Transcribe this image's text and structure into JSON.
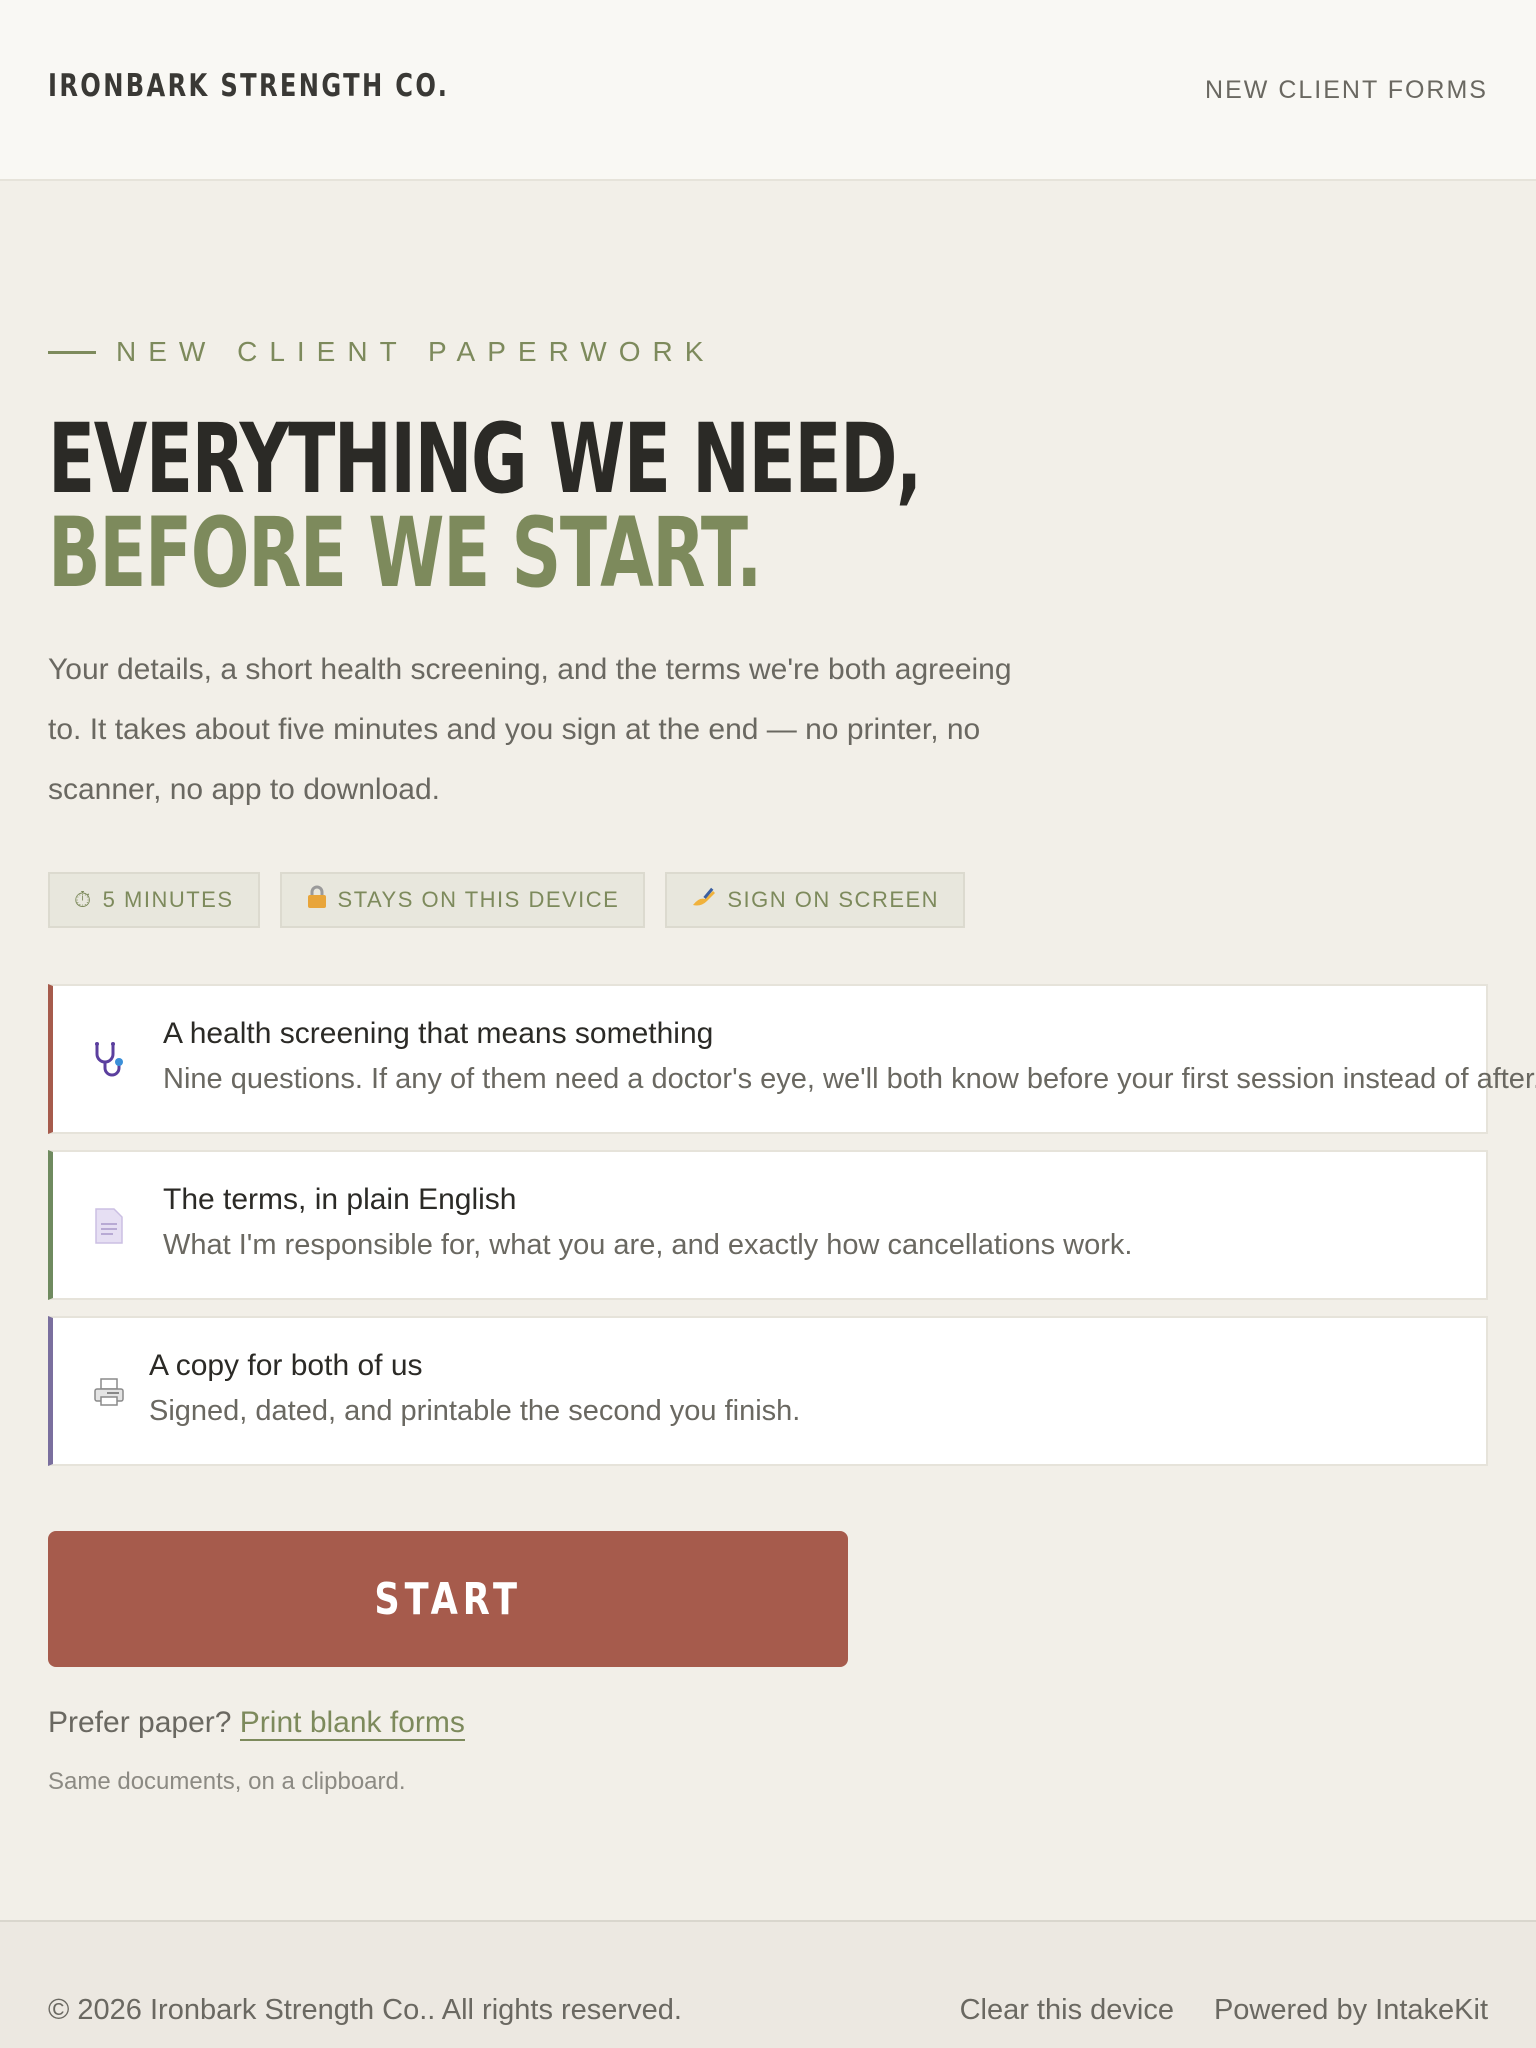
{
  "header": {
    "brand": "IRONBARK STRENGTH CO.",
    "nav_link": "NEW CLIENT FORMS"
  },
  "hero": {
    "eyebrow": "NEW CLIENT PAPERWORK",
    "headline_line1": "EVERYTHING WE NEED,",
    "headline_line2": "BEFORE WE START.",
    "lede": "Your details, a short health screening, and the terms we're both agreeing to. It takes about five minutes and you sign at the end — no printer, no scanner, no app to download."
  },
  "chips": [
    {
      "icon": "stopwatch-icon",
      "glyph": "⏱",
      "label": "5 MINUTES"
    },
    {
      "icon": "lock-icon",
      "glyph": "🔒",
      "label": "STAYS ON THIS DEVICE"
    },
    {
      "icon": "writing-hand-icon",
      "glyph": "✍",
      "label": "SIGN ON SCREEN"
    }
  ],
  "cards": [
    {
      "icon": "stethoscope-icon",
      "accent": "#a65b4c",
      "title": "A health screening that means something",
      "desc": "Nine questions. If any of them need a doctor's eye, we'll both know before your first session instead of after."
    },
    {
      "icon": "document-icon",
      "accent": "#6f8a5f",
      "title": "The terms, in plain English",
      "desc": "What I'm responsible for, what you are, and exactly how cancellations work."
    },
    {
      "icon": "printer-icon",
      "accent": "#7a6f9e",
      "title": "A copy for both of us",
      "desc": "Signed, dated, and printable the second you finish."
    }
  ],
  "start_button": "START",
  "paper": {
    "prompt": "Prefer paper?",
    "link": "Print blank forms",
    "note": "Same documents, on a clipboard."
  },
  "footer": {
    "copyright": "© 2026 Ironbark Strength Co.. All rights reserved.",
    "clear_link": "Clear this device",
    "powered": "Powered by IntakeKit"
  },
  "colors": {
    "accent_green": "#7d8a5c",
    "accent_red": "#a65b4c",
    "background": "#f2efe8"
  }
}
